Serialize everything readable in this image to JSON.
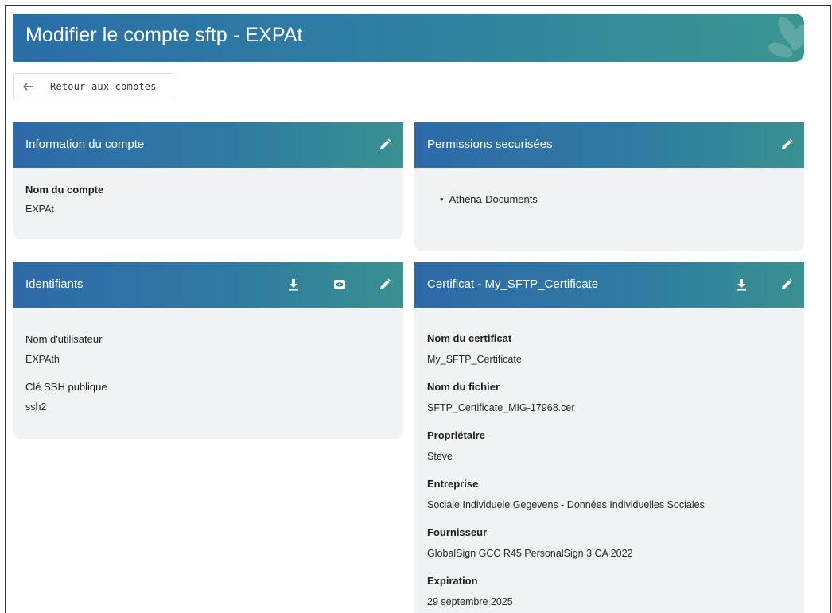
{
  "page": {
    "title": "Modifier le compte sftp - EXPAt",
    "back_label": "Retour aux comptes"
  },
  "colors": {
    "header_start": "#2a6ea8",
    "header_end": "#3a9590",
    "card_bg": "#f1f2f4"
  },
  "account_card": {
    "title": "Information du compte",
    "name_label": "Nom du compte",
    "name_value": "EXPAt",
    "icons": [
      "pencil-icon"
    ]
  },
  "permissions_card": {
    "title": "Permissions securisées",
    "items": [
      "Athena-Documents"
    ],
    "icons": [
      "pencil-icon"
    ]
  },
  "credentials_card": {
    "title": "Identifiants",
    "username_label": "Nom d'utilisateur",
    "username_value": "EXPAth",
    "ssh_label": "Clé SSH publique",
    "ssh_value": "ssh2",
    "icons": [
      "download-icon",
      "eye-icon",
      "pencil-icon"
    ]
  },
  "certificate_card": {
    "title": "Certificat - My_SFTP_Certificate",
    "icons": [
      "download-icon",
      "pencil-icon"
    ],
    "fields": [
      {
        "label": "Nom du certificat",
        "value": "My_SFTP_Certificate"
      },
      {
        "label": "Nom du fichier",
        "value": "SFTP_Certificate_MIG-17968.cer"
      },
      {
        "label": "Propriétaire",
        "value": "Steve"
      },
      {
        "label": "Entreprise",
        "value": "Sociale Individuele Gegevens - Données Individuelles Sociales"
      },
      {
        "label": "Fournisseur",
        "value": "GlobalSign GCC R45 PersonalSign 3 CA 2022"
      },
      {
        "label": "Expiration",
        "value": "29 septembre 2025"
      }
    ]
  }
}
